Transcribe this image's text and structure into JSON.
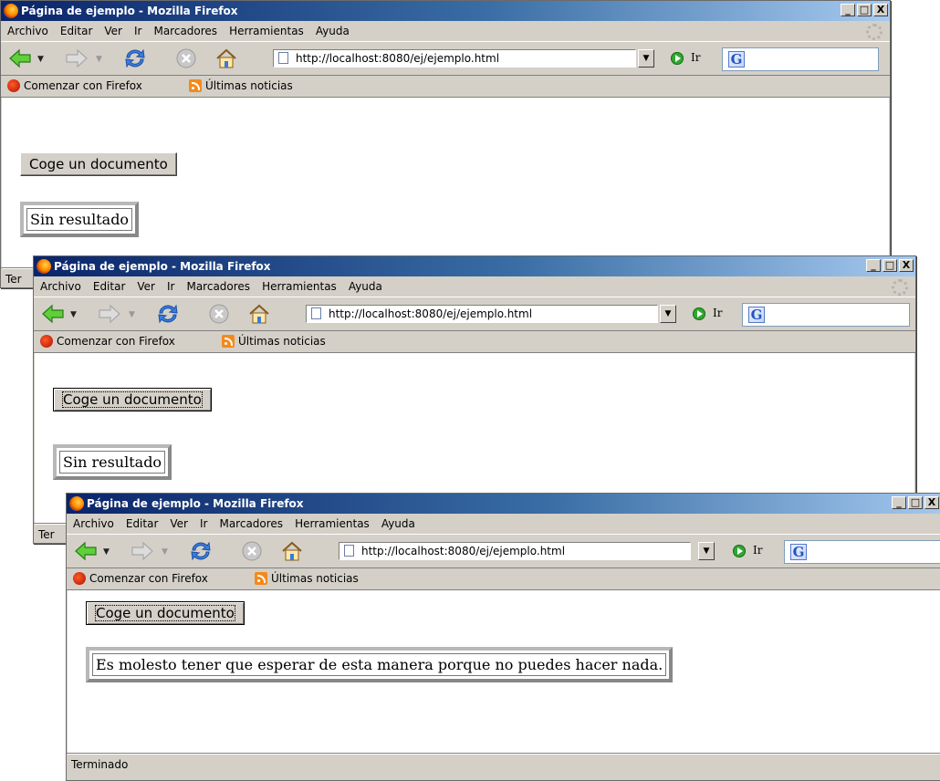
{
  "windows": [
    {
      "title": "Página de ejemplo - Mozilla Firefox",
      "window_buttons": [
        "_",
        "□",
        "X"
      ],
      "menu": [
        "Archivo",
        "Editar",
        "Ver",
        "Ir",
        "Marcadores",
        "Herramientas",
        "Ayuda"
      ],
      "url": "http://localhost:8080/ej/ejemplo.html",
      "go_label": "Ir",
      "bookmarks": [
        "Comenzar con Firefox",
        "Últimas noticias"
      ],
      "button_label": "Coge un documento",
      "button_focused": false,
      "result_text": "Sin resultado",
      "status": "Ter"
    },
    {
      "title": "Página de ejemplo - Mozilla Firefox",
      "window_buttons": [
        "_",
        "□",
        "X"
      ],
      "menu": [
        "Archivo",
        "Editar",
        "Ver",
        "Ir",
        "Marcadores",
        "Herramientas",
        "Ayuda"
      ],
      "url": "http://localhost:8080/ej/ejemplo.html",
      "go_label": "Ir",
      "bookmarks": [
        "Comenzar con Firefox",
        "Últimas noticias"
      ],
      "button_label": "Coge un documento",
      "button_focused": true,
      "result_text": "Sin resultado",
      "status": "Ter"
    },
    {
      "title": "Página de ejemplo - Mozilla Firefox",
      "window_buttons": [
        "_",
        "□",
        "X"
      ],
      "menu": [
        "Archivo",
        "Editar",
        "Ver",
        "Ir",
        "Marcadores",
        "Herramientas",
        "Ayuda"
      ],
      "url": "http://localhost:8080/ej/ejemplo.html",
      "go_label": "Ir",
      "bookmarks": [
        "Comenzar con Firefox",
        "Últimas noticias"
      ],
      "button_label": "Coge un documento",
      "button_focused": true,
      "result_text": "Es molesto tener que esperar de esta manera porque no puedes hacer nada.",
      "status": "Terminado"
    }
  ]
}
